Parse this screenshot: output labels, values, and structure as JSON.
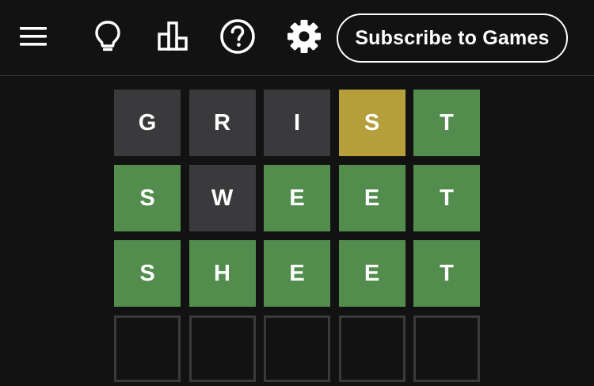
{
  "header": {
    "icons": [
      "menu-icon",
      "lightbulb-icon",
      "stats-icon",
      "help-icon",
      "gear-icon"
    ],
    "subscribe_label": "Subscribe to Games"
  },
  "colors": {
    "background": "#121213",
    "correct": "#538d4e",
    "present": "#b59f3b",
    "absent": "#3a3a3c",
    "empty_border": "#3a3a3c"
  },
  "board": {
    "rows": [
      [
        {
          "letter": "G",
          "state": "absent"
        },
        {
          "letter": "R",
          "state": "absent"
        },
        {
          "letter": "I",
          "state": "absent"
        },
        {
          "letter": "S",
          "state": "present"
        },
        {
          "letter": "T",
          "state": "correct"
        }
      ],
      [
        {
          "letter": "S",
          "state": "correct"
        },
        {
          "letter": "W",
          "state": "absent"
        },
        {
          "letter": "E",
          "state": "correct"
        },
        {
          "letter": "E",
          "state": "correct"
        },
        {
          "letter": "T",
          "state": "correct"
        }
      ],
      [
        {
          "letter": "S",
          "state": "correct"
        },
        {
          "letter": "H",
          "state": "correct"
        },
        {
          "letter": "E",
          "state": "correct"
        },
        {
          "letter": "E",
          "state": "correct"
        },
        {
          "letter": "T",
          "state": "correct"
        }
      ],
      [
        {
          "letter": "",
          "state": "empty"
        },
        {
          "letter": "",
          "state": "empty"
        },
        {
          "letter": "",
          "state": "empty"
        },
        {
          "letter": "",
          "state": "empty"
        },
        {
          "letter": "",
          "state": "empty"
        }
      ]
    ]
  }
}
